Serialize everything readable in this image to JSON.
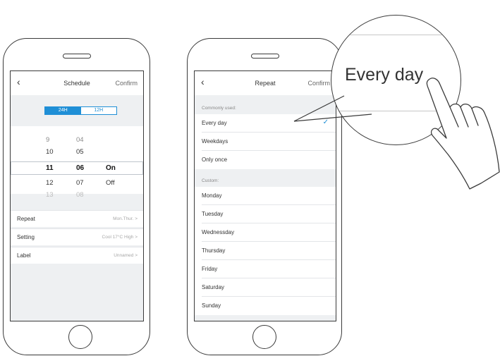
{
  "schedule": {
    "back_icon": "chevron-left-icon",
    "back_glyph": "‹",
    "title": "Schedule",
    "confirm": "Confirm",
    "format_toggle": [
      "24H",
      "12H"
    ],
    "picker": {
      "hours": [
        "9",
        "10",
        "11",
        "12",
        "13"
      ],
      "minutes": [
        "04",
        "05",
        "06",
        "07",
        "08"
      ],
      "states": [
        "On",
        "Off"
      ]
    },
    "settings": [
      {
        "label": "Repeat",
        "value": "Mon.Thur. >"
      },
      {
        "label": "Setting",
        "value": "Cool 17°C High >"
      },
      {
        "label": "Label",
        "value": "Unnamed >"
      }
    ]
  },
  "repeat": {
    "back_glyph": "‹",
    "title": "Repeat",
    "confirm": "Confirm",
    "common_header": "Commonly used:",
    "common": [
      "Every day",
      "Weekdays",
      "Only once"
    ],
    "check_glyph": "✓",
    "custom_header": "Custom:",
    "custom": [
      "Monday",
      "Tuesday",
      "Wednessday",
      "Thursday",
      "Friday",
      "Saturday",
      "Sunday"
    ]
  },
  "zoom": {
    "text": "Every day"
  },
  "colors": {
    "accent": "#1f8fd6",
    "screen_bg": "#eef0f2",
    "outline": "#3a3a3a"
  }
}
